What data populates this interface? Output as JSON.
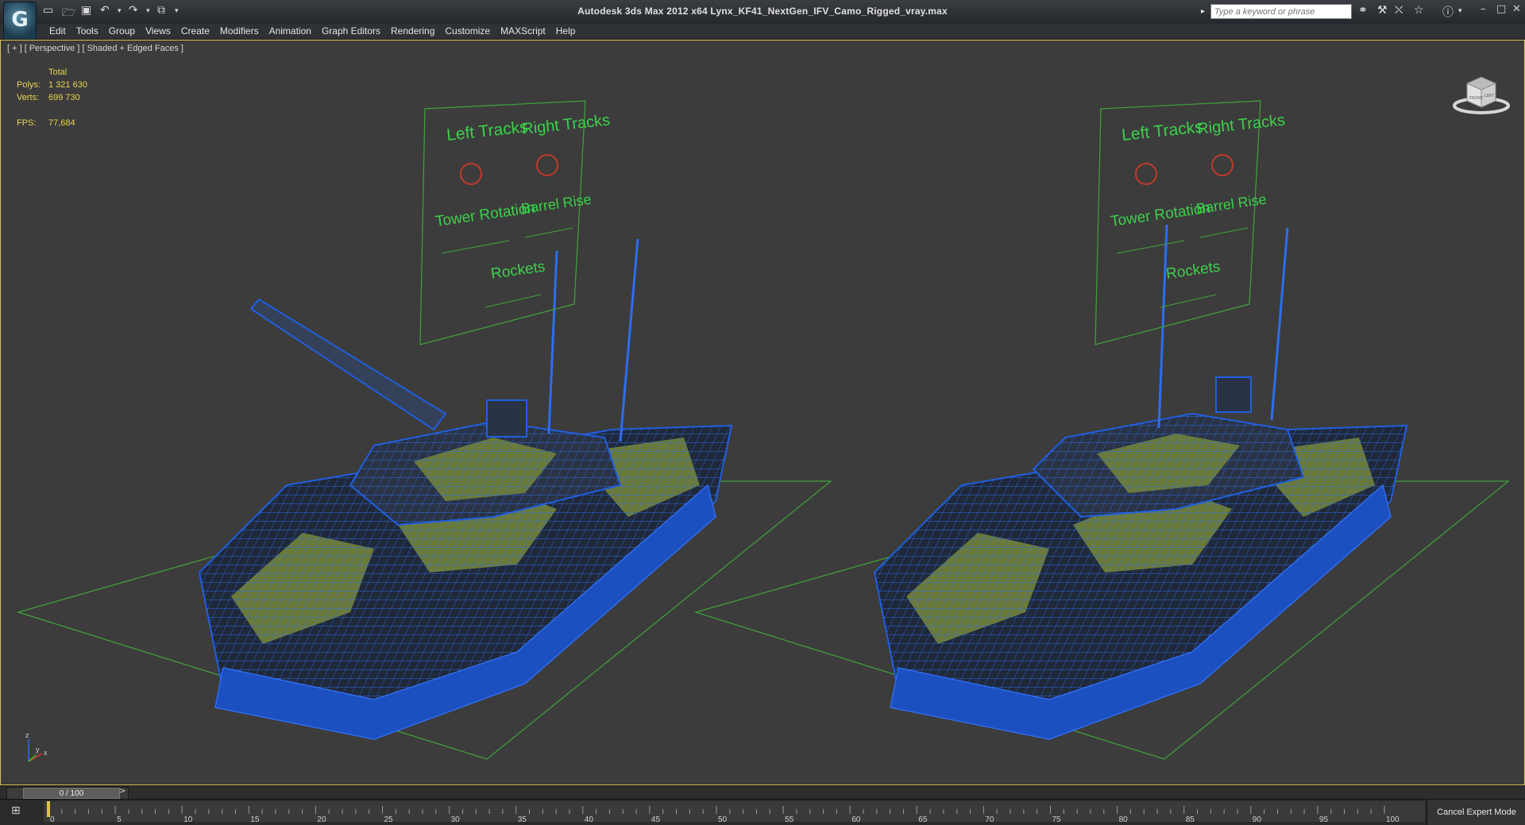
{
  "app": {
    "title": "Autodesk 3ds Max  2012 x64      Lynx_KF41_NextGen_IFV_Camo_Rigged_vray.max",
    "logo_glyph": "G"
  },
  "quick_access": {
    "icons": [
      "new-file-icon",
      "open-folder-icon",
      "save-icon",
      "undo-icon",
      "redo-icon",
      "project-folder-icon",
      "dropdown-icon"
    ]
  },
  "search": {
    "placeholder": "Type a keyword or phrase"
  },
  "menu": {
    "items": [
      "Edit",
      "Tools",
      "Group",
      "Views",
      "Create",
      "Modifiers",
      "Animation",
      "Graph Editors",
      "Rendering",
      "Customize",
      "MAXScript",
      "Help"
    ]
  },
  "viewport": {
    "label": "[ + ] [ Perspective ] [ Shaded + Edged Faces ]",
    "stats": {
      "header": "Total",
      "polys_label": "Polys:",
      "polys_value": "1 321 630",
      "verts_label": "Verts:",
      "verts_value": "699 730",
      "fps_label": "FPS:",
      "fps_value": "77,684"
    },
    "rig_panel": {
      "left_tracks": "Left Tracks",
      "right_tracks": "Right Tracks",
      "tower_rotation": "Tower Rotation",
      "barrel_rise": "Barrel Rise",
      "rockets": "Rockets"
    },
    "axis": {
      "z": "z",
      "x": "x",
      "y": "y"
    },
    "viewcube": {
      "front": "FRONT",
      "left": "LEFT"
    }
  },
  "timeslider": {
    "value": "0 / 100",
    "prev": "<",
    "next": ">"
  },
  "trackbar": {
    "ticks": [
      "0",
      "5",
      "10",
      "15",
      "20",
      "25",
      "30",
      "35",
      "40",
      "45",
      "50",
      "55",
      "60",
      "65",
      "70",
      "75",
      "80",
      "85",
      "90",
      "95",
      "100"
    ]
  },
  "status": {
    "cancel_expert_mode": "Cancel Expert Mode"
  },
  "colors": {
    "viewport_bg": "#3c3c3c",
    "stats_text": "#e9d451",
    "wire_blue": "#1f5fe0",
    "camo_olive": "#6a7a3a",
    "camo_dark": "#1f2630",
    "grid_green": "#3fa43a",
    "rig_text_green": "#3bd14a",
    "viewport_border": "#d8c25a"
  }
}
